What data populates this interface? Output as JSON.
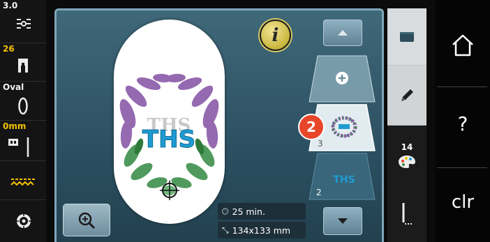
{
  "left_status": {
    "tension": {
      "value": "3.0",
      "icon": "thread-tension-icon"
    },
    "presser_foot": {
      "value": "26",
      "icon": "presser-foot-icon"
    },
    "hoop": {
      "value": "Oval",
      "icon": "hoop-icon"
    },
    "needle": {
      "value": "0mm",
      "icon": "needle-position-icon"
    },
    "feed_dog": {
      "icon": "feed-dog-icon"
    },
    "bobbin": {
      "icon": "bobbin-icon"
    }
  },
  "main": {
    "design_text": "THS",
    "info_label": "i",
    "time": {
      "icon": "clock-icon",
      "value": "25 min."
    },
    "size": {
      "icon": "resize-icon",
      "value": "134x133 mm"
    },
    "layers": [
      {
        "number": "",
        "content": "add-icon"
      },
      {
        "number": "3",
        "content": "wreath-thumbnail"
      },
      {
        "number": "2",
        "content": "text-thumbnail",
        "thumb_text": "THS"
      }
    ],
    "callout": "2"
  },
  "tabs": {
    "items": [
      {
        "name": "file",
        "icon": "folder-icon"
      },
      {
        "name": "edit",
        "icon": "pencil-icon"
      },
      {
        "name": "color",
        "icon": "palette-icon",
        "badge": "14"
      },
      {
        "name": "embroider",
        "icon": "needle-stitch-icon"
      }
    ]
  },
  "system": {
    "home": "home-icon",
    "help": "?",
    "clear": "clr"
  },
  "colors": {
    "panel": "#2d5263",
    "accent_yellow": "#f2c200",
    "badge_red": "#e8462b",
    "design_blue": "#1f9bd1",
    "leaf_purple": "#8a5aa8",
    "leaf_green": "#3e8f4c"
  }
}
